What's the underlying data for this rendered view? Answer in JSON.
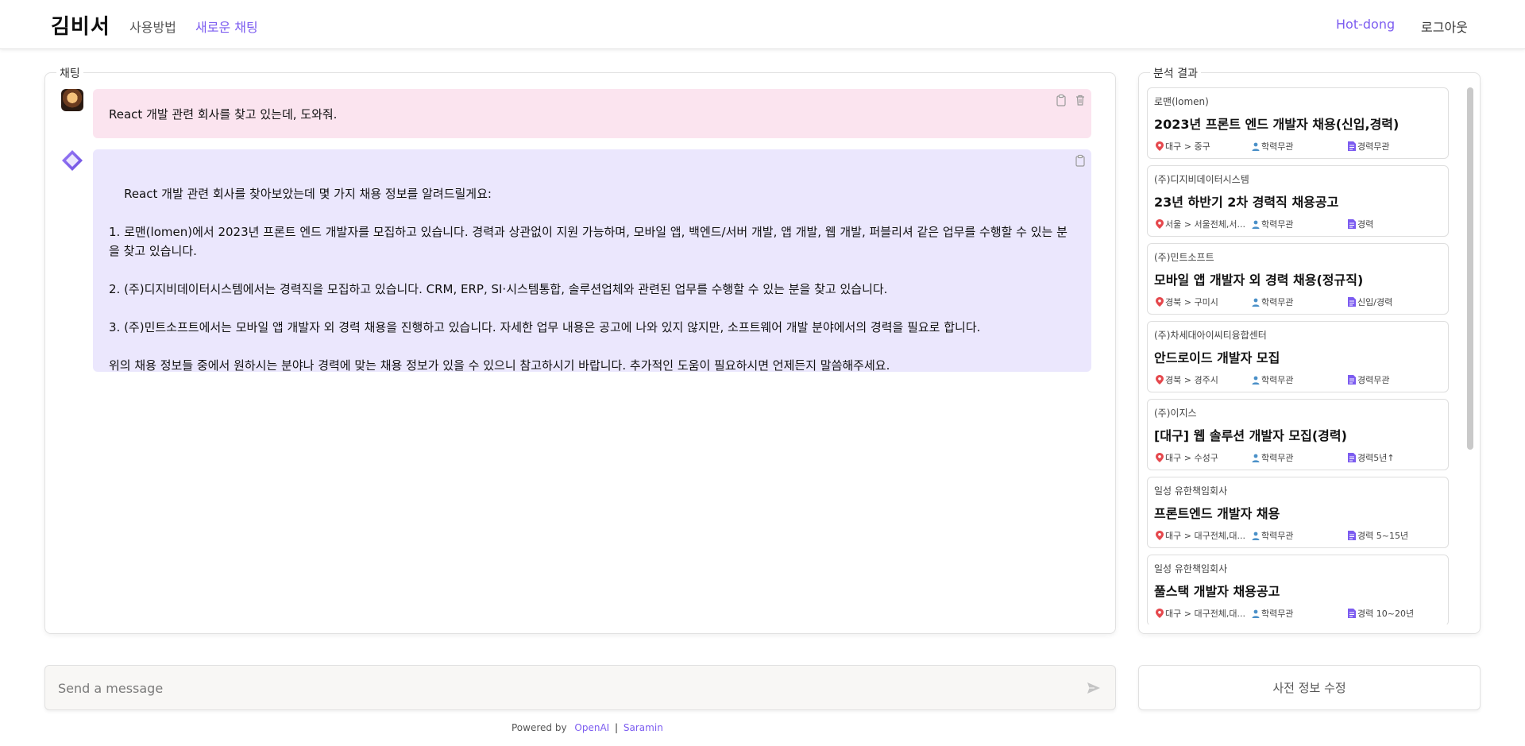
{
  "header": {
    "brand": "김비서",
    "nav": {
      "guide": "사용방법",
      "new_chat": "새로운 채팅"
    },
    "user": "Hot-dong",
    "logout": "로그아웃"
  },
  "chat": {
    "legend": "채팅",
    "user_message": "React 개발 관련 회사를 찾고 있는데, 도와줘.",
    "bot_message": "React 개발 관련 회사를 찾아보았는데 몇 가지 채용 정보를 알려드릴게요:\n\n1. 로맨(lomen)에서 2023년 프론트 엔드 개발자를 모집하고 있습니다. 경력과 상관없이 지원 가능하며, 모바일 앱, 백엔드/서버 개발, 앱 개발, 웹 개발, 퍼블리셔 같은 업무를 수행할 수 있는 분을 찾고 있습니다.\n\n2. (주)디지비데이터시스템에서는 경력직을 모집하고 있습니다. CRM, ERP, SI·시스템통합, 솔루션업체와 관련된 업무를 수행할 수 있는 분을 찾고 있습니다.\n\n3. (주)민트소프트에서는 모바일 앱 개발자 외 경력 채용을 진행하고 있습니다. 자세한 업무 내용은 공고에 나와 있지 않지만, 소프트웨어 개발 분야에서의 경력을 필요로 합니다.\n\n위의 채용 정보들 중에서 원하시는 분야나 경력에 맞는 채용 정보가 있을 수 있으니 참고하시기 바랍니다. 추가적인 도움이 필요하시면 언제든지 말씀해주세요."
  },
  "results": {
    "legend": "분석 결과",
    "jobs": [
      {
        "company": "로맨(lomen)",
        "title": "2023년 프론트 엔드 개발자 채용(신입,경력)",
        "location": "대구 > 중구",
        "education": "학력무관",
        "experience": "경력무관"
      },
      {
        "company": "(주)디지비데이터시스템",
        "title": "23년 하반기 2차 경력직 채용공고",
        "location": "서울 > 서울전체,서...",
        "education": "학력무관",
        "experience": "경력"
      },
      {
        "company": "(주)민트소프트",
        "title": "모바일 앱 개발자 외 경력 채용(정규직)",
        "location": "경북 > 구미시",
        "education": "학력무관",
        "experience": "신입/경력"
      },
      {
        "company": "(주)차세대아이씨티융합센터",
        "title": "안드로이드 개발자 모집",
        "location": "경북 > 경주시",
        "education": "학력무관",
        "experience": "경력무관"
      },
      {
        "company": "(주)이지스",
        "title": "[대구] 웹 솔루션 개발자 모집(경력)",
        "location": "대구 > 수성구",
        "education": "학력무관",
        "experience": "경력5년↑"
      },
      {
        "company": "일성 유한책임회사",
        "title": "프론트엔드 개발자 채용",
        "location": "대구 > 대구전체,대...",
        "education": "학력무관",
        "experience": "경력 5~15년"
      },
      {
        "company": "일성 유한책임회사",
        "title": "풀스택 개발자 채용공고",
        "location": "대구 > 대구전체,대...",
        "education": "학력무관",
        "experience": "경력 10~20년"
      }
    ]
  },
  "input": {
    "placeholder": "Send a message"
  },
  "edit_button": "사전 정보 수정",
  "footer": {
    "powered_by": "Powered by",
    "openai": "OpenAI",
    "separator": "|",
    "saramin": "Saramin"
  },
  "colors": {
    "accent": "#7c5cf0",
    "user_bubble": "#fbe4ef",
    "bot_bubble": "#ebe7fd",
    "location_pin": "#e5484d",
    "edu_icon": "#4a90c8",
    "exp_icon": "#7c5cf0"
  }
}
